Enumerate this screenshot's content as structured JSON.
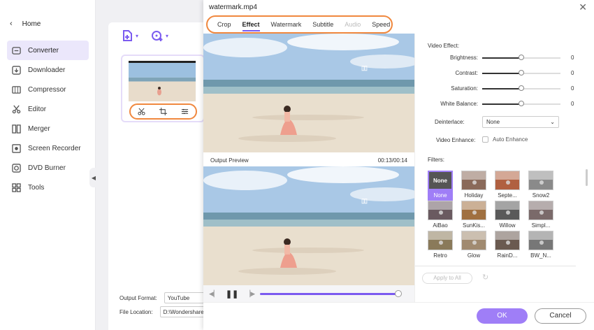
{
  "sidebar": {
    "home_label": "Home",
    "items": [
      {
        "label": "Converter",
        "icon": "converter-icon",
        "active": true
      },
      {
        "label": "Downloader",
        "icon": "downloader-icon"
      },
      {
        "label": "Compressor",
        "icon": "compressor-icon"
      },
      {
        "label": "Editor",
        "icon": "editor-icon"
      },
      {
        "label": "Merger",
        "icon": "merger-icon"
      },
      {
        "label": "Screen Recorder",
        "icon": "screen-recorder-icon"
      },
      {
        "label": "DVD Burner",
        "icon": "dvd-burner-icon"
      },
      {
        "label": "Tools",
        "icon": "tools-icon"
      }
    ]
  },
  "background": {
    "output_format_label": "Output Format:",
    "output_format_value": "YouTube",
    "file_location_label": "File Location:",
    "file_location_value": "D:\\Wondershare"
  },
  "dialog": {
    "title": "watermark.mp4",
    "tabs": [
      {
        "label": "Crop"
      },
      {
        "label": "Effect",
        "active": true
      },
      {
        "label": "Watermark"
      },
      {
        "label": "Subtitle"
      },
      {
        "label": "Audio",
        "disabled": true
      },
      {
        "label": "Speed"
      }
    ],
    "output_preview_label": "Output Preview",
    "time": "00:13/00:14",
    "progress": 0.97,
    "video_effect_label": "Video Effect:",
    "sliders": [
      {
        "label": "Brightness:",
        "value": "0",
        "pos": 0.5
      },
      {
        "label": "Contrast:",
        "value": "0",
        "pos": 0.5
      },
      {
        "label": "Saturation:",
        "value": "0",
        "pos": 0.5
      },
      {
        "label": "White Balance:",
        "value": "0",
        "pos": 0.5
      }
    ],
    "deinterlace_label": "Deinterlace:",
    "deinterlace_value": "None",
    "video_enhance_label": "Video Enhance:",
    "auto_enhance_label": "Auto Enhance",
    "filters_label": "Filters:",
    "filters": [
      {
        "label": "None",
        "active": true,
        "tone": "#555"
      },
      {
        "label": "Holiday",
        "tone": "#8a6a5a"
      },
      {
        "label": "Septe...",
        "tone": "#b06040"
      },
      {
        "label": "Snow2",
        "tone": "#8a8a8a"
      },
      {
        "label": "AiBao",
        "tone": "#6a5a60"
      },
      {
        "label": "SunKis...",
        "tone": "#a07040"
      },
      {
        "label": "Willow",
        "tone": "#5a5a5a"
      },
      {
        "label": "Simpl...",
        "tone": "#7a6a6a"
      },
      {
        "label": "Retro",
        "tone": "#8a7a5a"
      },
      {
        "label": "Glow",
        "tone": "#a08a70"
      },
      {
        "label": "RainD...",
        "tone": "#6a5a50"
      },
      {
        "label": "BW_N...",
        "tone": "#777777"
      }
    ],
    "apply_all_label": "Apply to All",
    "ok_label": "OK",
    "cancel_label": "Cancel",
    "accent": "#9f7ef7",
    "highlight": "#f0883e"
  }
}
